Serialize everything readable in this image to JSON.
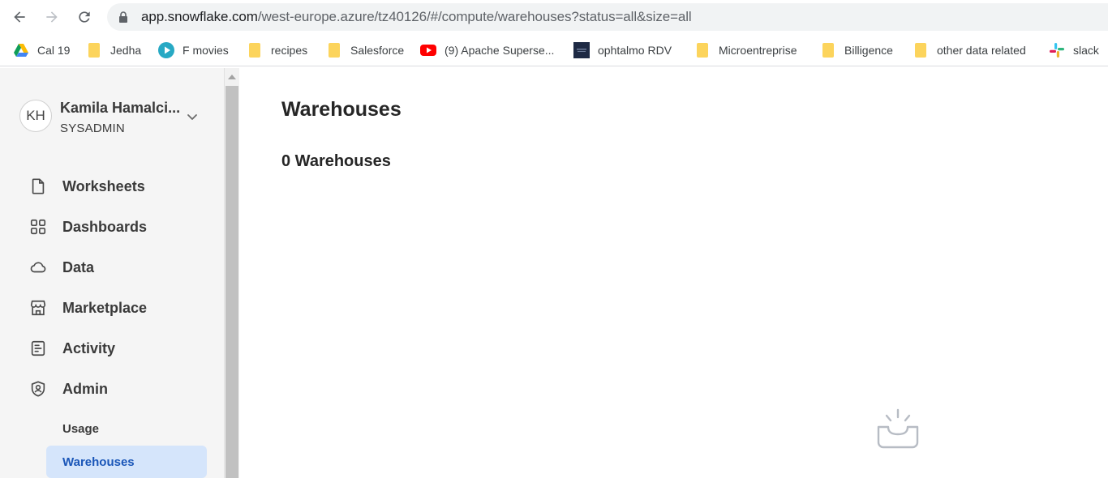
{
  "browser": {
    "url_host": "app.snowflake.com",
    "url_path": "/west-europe.azure/tz40126/#/compute/warehouses?status=all&size=all",
    "bookmarks": [
      {
        "label": "Cal 19",
        "icon": "google-drive-icon"
      },
      {
        "label": "Jedha",
        "icon": "folder-icon"
      },
      {
        "label": "F movies",
        "icon": "play-icon"
      },
      {
        "label": "recipes",
        "icon": "folder-icon"
      },
      {
        "label": "Salesforce",
        "icon": "folder-icon"
      },
      {
        "label": "(9) Apache Superse...",
        "icon": "youtube-icon"
      },
      {
        "label": "ophtalmo RDV",
        "icon": "site-thumbnail-icon"
      },
      {
        "label": "Microentreprise",
        "icon": "folder-icon"
      },
      {
        "label": "Billigence",
        "icon": "folder-icon"
      },
      {
        "label": "other data related",
        "icon": "folder-icon"
      },
      {
        "label": "slack",
        "icon": "slack-icon"
      }
    ]
  },
  "user": {
    "initials": "KH",
    "name": "Kamila Hamalci...",
    "role": "SYSADMIN"
  },
  "sidebar": {
    "items": [
      {
        "label": "Worksheets",
        "icon": "document-icon"
      },
      {
        "label": "Dashboards",
        "icon": "grid-icon"
      },
      {
        "label": "Data",
        "icon": "cloud-icon"
      },
      {
        "label": "Marketplace",
        "icon": "storefront-icon"
      },
      {
        "label": "Activity",
        "icon": "activity-icon"
      },
      {
        "label": "Admin",
        "icon": "shield-user-icon"
      }
    ],
    "admin_sub": [
      {
        "label": "Usage",
        "active": false
      },
      {
        "label": "Warehouses",
        "active": true
      }
    ]
  },
  "main": {
    "title": "Warehouses",
    "count_label": "0 Warehouses",
    "empty_icon": "empty-inbox-icon"
  },
  "colors": {
    "active_bg": "#d5e5fb",
    "active_text": "#1a56b8",
    "sidebar_bg": "#f5f5f5"
  }
}
